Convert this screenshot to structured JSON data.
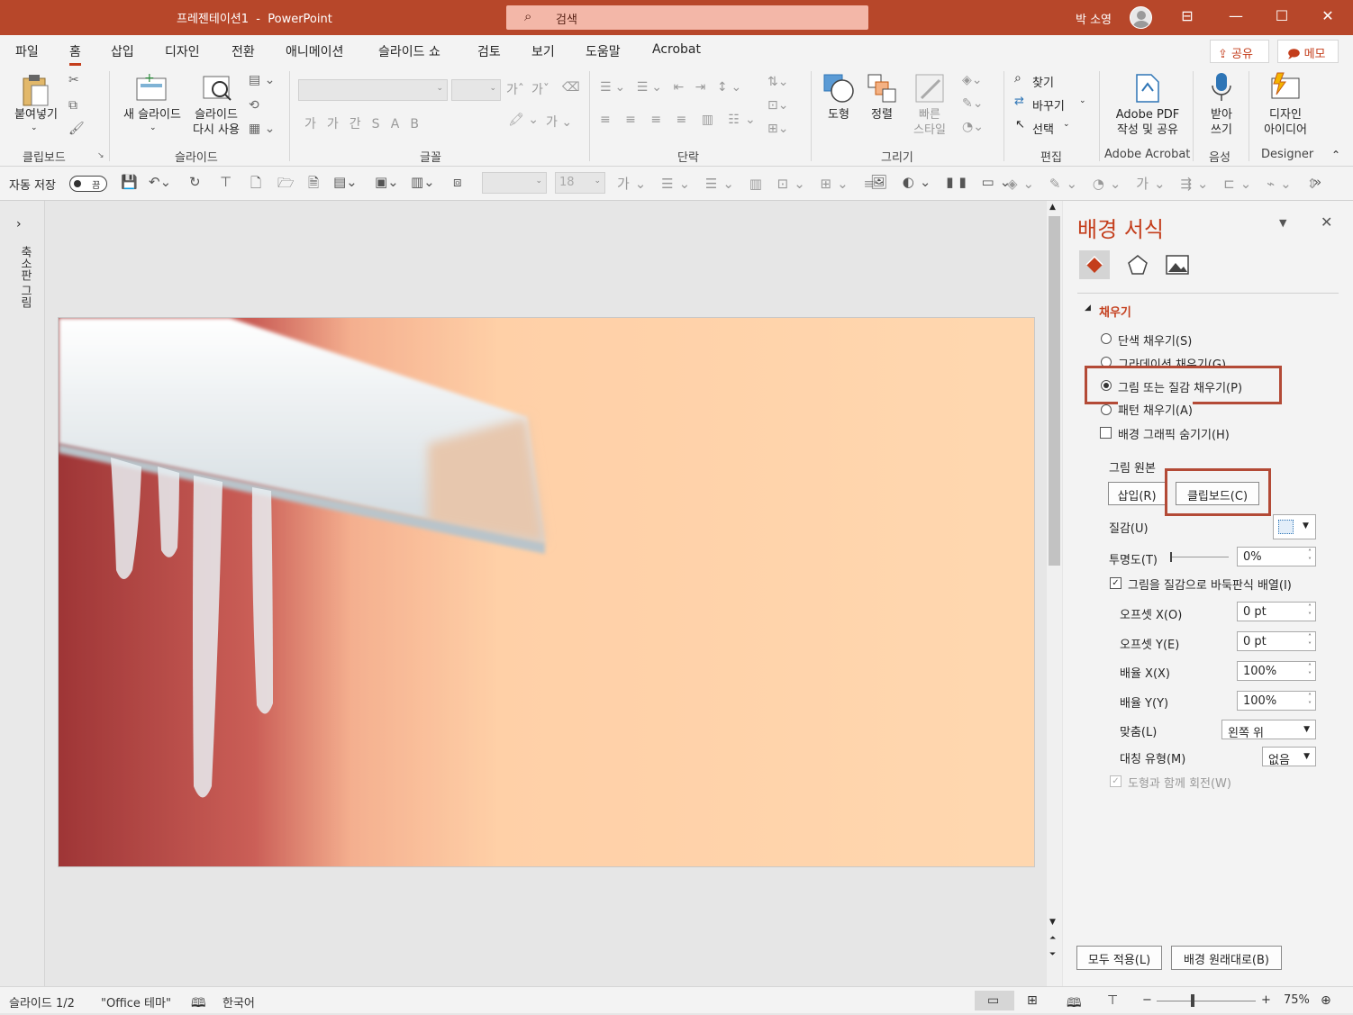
{
  "title": {
    "doc": "프레젠테이션1  -  PowerPoint",
    "search": "검색",
    "user": "박 소영"
  },
  "tabs": [
    "파일",
    "홈",
    "삽입",
    "디자인",
    "전환",
    "애니메이션",
    "슬라이드 쇼",
    "검토",
    "보기",
    "도움말",
    "Acrobat"
  ],
  "share": "공유",
  "memo": "메모",
  "ribbon": {
    "paste": "붙여넣기",
    "new_slide": "새 슬라이드",
    "reuse_slide_1": "슬라이드",
    "reuse_slide_2": "다시 사용",
    "shape": "도형",
    "arrange": "정렬",
    "quick_1": "빠른",
    "quick_2": "스타일",
    "find": "찾기",
    "replace": "바꾸기",
    "select": "선택",
    "adobe_1": "Adobe PDF",
    "adobe_2": "작성 및 공유",
    "dictate_1": "받아",
    "dictate_2": "쓰기",
    "design_1": "디자인",
    "design_2": "아이디어",
    "font_size": "",
    "groups": {
      "clipboard": "클립보드",
      "slides": "슬라이드",
      "font": "글꼴",
      "paragraph": "단락",
      "drawing": "그리기",
      "editing": "편집",
      "acrobat": "Adobe Acrobat",
      "voice": "음성",
      "designer": "Designer"
    }
  },
  "qat": {
    "autosave": "자동 저장",
    "toggle": "끔",
    "font_size": "18"
  },
  "leftpane": {
    "label": "축소판 그림"
  },
  "panel": {
    "title": "배경 서식",
    "section": "채우기",
    "options": {
      "solid": "단색 채우기(S)",
      "gradient": "그라데이션 채우기(G)",
      "picture": "그림 또는 질감 채우기(P)",
      "pattern": "패턴 채우기(A)",
      "hide": "배경 그래픽 숨기기(H)"
    },
    "source": "그림 원본",
    "insert": "삽입(R)",
    "clipboard": "클립보드(C)",
    "texture": "질감(U)",
    "transparency": "투명도(T)",
    "transparency_val": "0%",
    "tile": "그림을 질감으로 바둑판식 배열(I)",
    "offset_x": "오프셋 X(O)",
    "offset_x_val": "0 pt",
    "offset_y": "오프셋 Y(E)",
    "offset_y_val": "0 pt",
    "scale_x": "배율 X(X)",
    "scale_x_val": "100%",
    "scale_y": "배율 Y(Y)",
    "scale_y_val": "100%",
    "align": "맞춤(L)",
    "align_val": "왼쪽 위",
    "mirror": "대칭 유형(M)",
    "mirror_val": "없음",
    "rotate": "도형과 함께 회전(W)",
    "apply_all": "모두 적용(L)",
    "reset": "배경 원래대로(B)"
  },
  "status": {
    "slide": "슬라이드 1/2",
    "theme": "\"Office 테마\"",
    "lang": "한국어",
    "zoom": "75%"
  }
}
